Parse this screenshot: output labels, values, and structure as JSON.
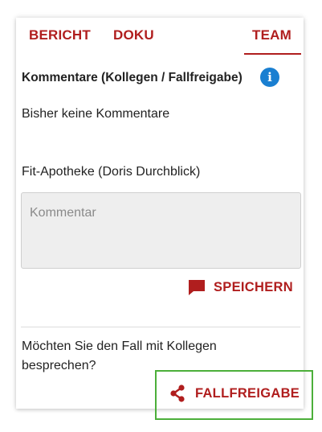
{
  "tabs": [
    {
      "label": "BERICHT"
    },
    {
      "label": "DOKU"
    },
    {
      "label": "TEAM",
      "active": true
    }
  ],
  "comments": {
    "title": "Kommentare (Kollegen / Fallfreigabe)",
    "info_icon": "i",
    "empty_text": "Bisher keine Kommentare",
    "author": "Fit-Apotheke (Doris Durchblick)",
    "input_placeholder": "Kommentar",
    "input_value": "",
    "save_label": "SPEICHERN",
    "save_icon": "comment-icon"
  },
  "share": {
    "question": "Möchten Sie den Fall mit Kollegen besprechen?",
    "button_label": "FALLFREIGABE",
    "button_icon": "share-icon"
  },
  "colors": {
    "accent": "#b01e1e",
    "info": "#1a7fd1",
    "highlight": "#4caf3a"
  }
}
